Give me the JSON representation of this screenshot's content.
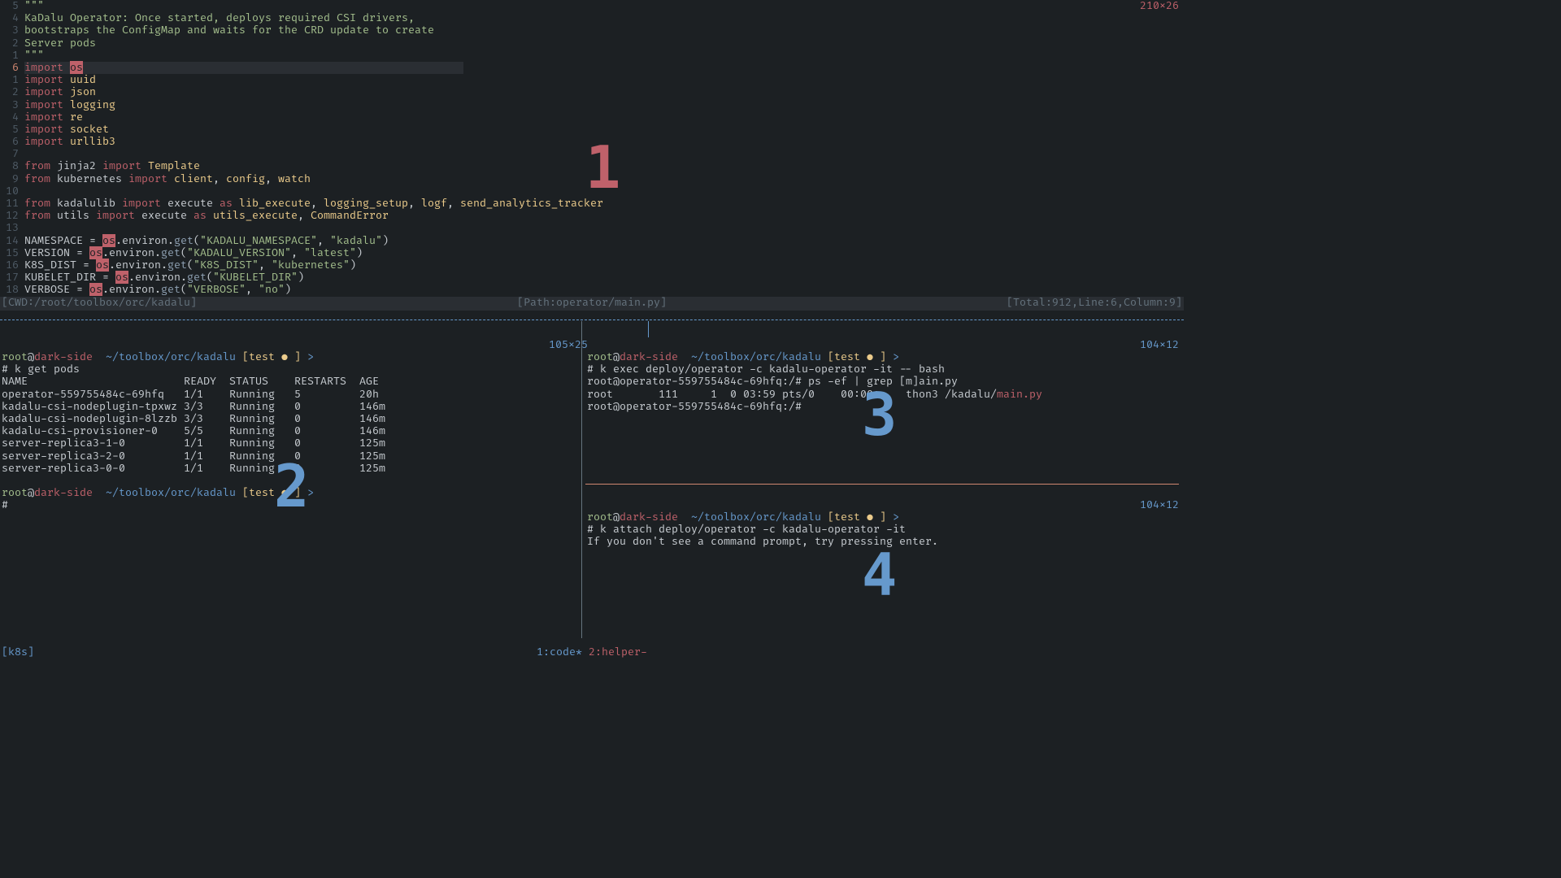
{
  "top_dims": "210x26",
  "editor": {
    "gutter": [
      "5",
      "4",
      "3",
      "2",
      "1",
      "6",
      "1",
      "2",
      "3",
      "4",
      "5",
      "6",
      "7",
      "8",
      "9",
      "10",
      "11",
      "12",
      "13",
      "14",
      "15",
      "16",
      "17",
      "18"
    ],
    "current_line_index": 5,
    "lines": [
      {
        "segments": [
          {
            "t": "\"\"\"",
            "c": "c-str"
          }
        ]
      },
      {
        "segments": [
          {
            "t": "KaDalu Operator: Once started, deploys required CSI drivers,",
            "c": "c-str"
          }
        ]
      },
      {
        "segments": [
          {
            "t": "bootstraps the ConfigMap and waits for the CRD update to create",
            "c": "c-str"
          }
        ]
      },
      {
        "segments": [
          {
            "t": "Server pods",
            "c": "c-str"
          }
        ]
      },
      {
        "segments": [
          {
            "t": "\"\"\"",
            "c": "c-str"
          }
        ]
      },
      {
        "cursorline": true,
        "segments": [
          {
            "t": "import",
            "c": "c-kw"
          },
          {
            "t": " ",
            "c": ""
          },
          {
            "t": "os",
            "c": "c-hi"
          }
        ]
      },
      {
        "segments": [
          {
            "t": "import",
            "c": "c-kw"
          },
          {
            "t": " ",
            "c": ""
          },
          {
            "t": "uuid",
            "c": "c-mod"
          }
        ]
      },
      {
        "segments": [
          {
            "t": "import",
            "c": "c-kw"
          },
          {
            "t": " ",
            "c": ""
          },
          {
            "t": "json",
            "c": "c-mod"
          }
        ]
      },
      {
        "segments": [
          {
            "t": "import",
            "c": "c-kw"
          },
          {
            "t": " ",
            "c": ""
          },
          {
            "t": "logging",
            "c": "c-mod"
          }
        ]
      },
      {
        "segments": [
          {
            "t": "import",
            "c": "c-kw"
          },
          {
            "t": " ",
            "c": ""
          },
          {
            "t": "re",
            "c": "c-mod"
          }
        ]
      },
      {
        "segments": [
          {
            "t": "import",
            "c": "c-kw"
          },
          {
            "t": " ",
            "c": ""
          },
          {
            "t": "socket",
            "c": "c-mod"
          }
        ]
      },
      {
        "segments": [
          {
            "t": "import",
            "c": "c-kw"
          },
          {
            "t": " ",
            "c": ""
          },
          {
            "t": "urllib3",
            "c": "c-mod"
          }
        ]
      },
      {
        "segments": [
          {
            "t": "",
            "c": ""
          }
        ]
      },
      {
        "segments": [
          {
            "t": "from",
            "c": "c-kw"
          },
          {
            "t": " jinja2 ",
            "c": ""
          },
          {
            "t": "import",
            "c": "c-kw"
          },
          {
            "t": " ",
            "c": ""
          },
          {
            "t": "Template",
            "c": "c-mod"
          }
        ]
      },
      {
        "segments": [
          {
            "t": "from",
            "c": "c-kw"
          },
          {
            "t": " kubernetes ",
            "c": ""
          },
          {
            "t": "import",
            "c": "c-kw"
          },
          {
            "t": " ",
            "c": ""
          },
          {
            "t": "client",
            "c": "c-mod"
          },
          {
            "t": ", ",
            "c": ""
          },
          {
            "t": "config",
            "c": "c-mod"
          },
          {
            "t": ", ",
            "c": ""
          },
          {
            "t": "watch",
            "c": "c-mod"
          }
        ]
      },
      {
        "segments": [
          {
            "t": "",
            "c": ""
          }
        ]
      },
      {
        "segments": [
          {
            "t": "from",
            "c": "c-kw"
          },
          {
            "t": " kadalulib ",
            "c": ""
          },
          {
            "t": "import",
            "c": "c-kw"
          },
          {
            "t": " execute ",
            "c": ""
          },
          {
            "t": "as",
            "c": "c-kw"
          },
          {
            "t": " ",
            "c": ""
          },
          {
            "t": "lib_execute",
            "c": "c-mod"
          },
          {
            "t": ", ",
            "c": ""
          },
          {
            "t": "logging_setup",
            "c": "c-mod"
          },
          {
            "t": ", ",
            "c": ""
          },
          {
            "t": "logf",
            "c": "c-mod"
          },
          {
            "t": ", ",
            "c": ""
          },
          {
            "t": "send_analytics_tracker",
            "c": "c-mod"
          }
        ]
      },
      {
        "segments": [
          {
            "t": "from",
            "c": "c-kw"
          },
          {
            "t": " utils ",
            "c": ""
          },
          {
            "t": "import",
            "c": "c-kw"
          },
          {
            "t": " execute ",
            "c": ""
          },
          {
            "t": "as",
            "c": "c-kw"
          },
          {
            "t": " ",
            "c": ""
          },
          {
            "t": "utils_execute",
            "c": "c-mod"
          },
          {
            "t": ", ",
            "c": ""
          },
          {
            "t": "CommandError",
            "c": "c-mod"
          }
        ]
      },
      {
        "segments": [
          {
            "t": "",
            "c": ""
          }
        ]
      },
      {
        "segments": [
          {
            "t": "NAMESPACE = ",
            "c": ""
          },
          {
            "t": "os",
            "c": "c-hi"
          },
          {
            "t": ".environ.",
            "c": ""
          },
          {
            "t": "get",
            "c": "c-fn"
          },
          {
            "t": "(",
            "c": ""
          },
          {
            "t": "\"KADALU_NAMESPACE\"",
            "c": "c-str"
          },
          {
            "t": ", ",
            "c": ""
          },
          {
            "t": "\"kadalu\"",
            "c": "c-str"
          },
          {
            "t": ")",
            "c": ""
          }
        ]
      },
      {
        "segments": [
          {
            "t": "VERSION = ",
            "c": ""
          },
          {
            "t": "os",
            "c": "c-hi"
          },
          {
            "t": ".environ.",
            "c": ""
          },
          {
            "t": "get",
            "c": "c-fn"
          },
          {
            "t": "(",
            "c": ""
          },
          {
            "t": "\"KADALU_VERSION\"",
            "c": "c-str"
          },
          {
            "t": ", ",
            "c": ""
          },
          {
            "t": "\"latest\"",
            "c": "c-str"
          },
          {
            "t": ")",
            "c": ""
          }
        ]
      },
      {
        "segments": [
          {
            "t": "K8S_DIST = ",
            "c": ""
          },
          {
            "t": "os",
            "c": "c-hi"
          },
          {
            "t": ".environ.",
            "c": ""
          },
          {
            "t": "get",
            "c": "c-fn"
          },
          {
            "t": "(",
            "c": ""
          },
          {
            "t": "\"K8S_DIST\"",
            "c": "c-str"
          },
          {
            "t": ", ",
            "c": ""
          },
          {
            "t": "\"kubernetes\"",
            "c": "c-str"
          },
          {
            "t": ")",
            "c": ""
          }
        ]
      },
      {
        "segments": [
          {
            "t": "KUBELET_DIR = ",
            "c": ""
          },
          {
            "t": "os",
            "c": "c-hi"
          },
          {
            "t": ".environ.",
            "c": ""
          },
          {
            "t": "get",
            "c": "c-fn"
          },
          {
            "t": "(",
            "c": ""
          },
          {
            "t": "\"KUBELET_DIR\"",
            "c": "c-str"
          },
          {
            "t": ")",
            "c": ""
          }
        ]
      },
      {
        "segments": [
          {
            "t": "VERBOSE = ",
            "c": ""
          },
          {
            "t": "os",
            "c": "c-hi"
          },
          {
            "t": ".environ.",
            "c": ""
          },
          {
            "t": "get",
            "c": "c-fn"
          },
          {
            "t": "(",
            "c": ""
          },
          {
            "t": "\"VERBOSE\"",
            "c": "c-str"
          },
          {
            "t": ", ",
            "c": ""
          },
          {
            "t": "\"no\"",
            "c": "c-str"
          },
          {
            "t": ")",
            "c": ""
          }
        ]
      }
    ]
  },
  "statusbar": {
    "left": "[CWD:/root/toolbox/orc/kadalu]",
    "mid": "[Path:operator/main.py]",
    "right": "[Total:912,Line:6,Column:9]"
  },
  "pane2": {
    "dims": "105x25",
    "prompt": {
      "user": "root",
      "at": "@",
      "host": "dark-side",
      "path": "  ~/toolbox/orc/kadalu ",
      "branch": "[test ",
      "dot": "●",
      "close": " ] ",
      "arrow": ">"
    },
    "cmd1": "# k get pods",
    "table": {
      "header": [
        "NAME",
        "READY",
        "STATUS",
        "RESTARTS",
        "AGE"
      ],
      "rows": [
        [
          "operator-559755484c-69hfq",
          "1/1",
          "Running",
          "5",
          "20h"
        ],
        [
          "kadalu-csi-nodeplugin-tpxwz",
          "3/3",
          "Running",
          "0",
          "146m"
        ],
        [
          "kadalu-csi-nodeplugin-8lzzb",
          "3/3",
          "Running",
          "0",
          "146m"
        ],
        [
          "kadalu-csi-provisioner-0",
          "5/5",
          "Running",
          "0",
          "146m"
        ],
        [
          "server-replica3-1-0",
          "1/1",
          "Running",
          "0",
          "125m"
        ],
        [
          "server-replica3-2-0",
          "1/1",
          "Running",
          "0",
          "125m"
        ],
        [
          "server-replica3-0-0",
          "1/1",
          "Running",
          "0",
          "125m"
        ]
      ]
    },
    "cmd2": "#"
  },
  "pane3": {
    "dims": "104x12",
    "prompt": {
      "user": "root",
      "at": "@",
      "host": "dark-side",
      "path": "  ~/toolbox/orc/kadalu ",
      "branch": "[test ",
      "dot": "●",
      "close": " ] ",
      "arrow": ">"
    },
    "l1": "# k exec deploy/operator -c kadalu-operator -it -- bash",
    "l2": "root@operator-559755484c-69hfq:/# ps -ef | grep [m]ain.py",
    "l3a": "root       111     1  0 03:59 pts/0    00:00:",
    "l3b": "thon3 /kadalu/",
    "l3c": "main.py",
    "l4": "root@operator-559755484c-69hfq:/#"
  },
  "pane4": {
    "dims": "104x12",
    "prompt": {
      "user": "root",
      "at": "@",
      "host": "dark-side",
      "path": "  ~/toolbox/orc/kadalu ",
      "branch": "[test ",
      "dot": "●",
      "close": " ] ",
      "arrow": ">"
    },
    "l1": "# k attach deploy/operator -c kadalu-operator -it",
    "l2": "If you don't see a command prompt, try pressing enter."
  },
  "footer": {
    "session": "[k8s]",
    "win1": "1:code*",
    "win2": " 2:helper-"
  },
  "pane_numbers": {
    "one": "1",
    "two": "2",
    "three": "3",
    "four": "4"
  }
}
